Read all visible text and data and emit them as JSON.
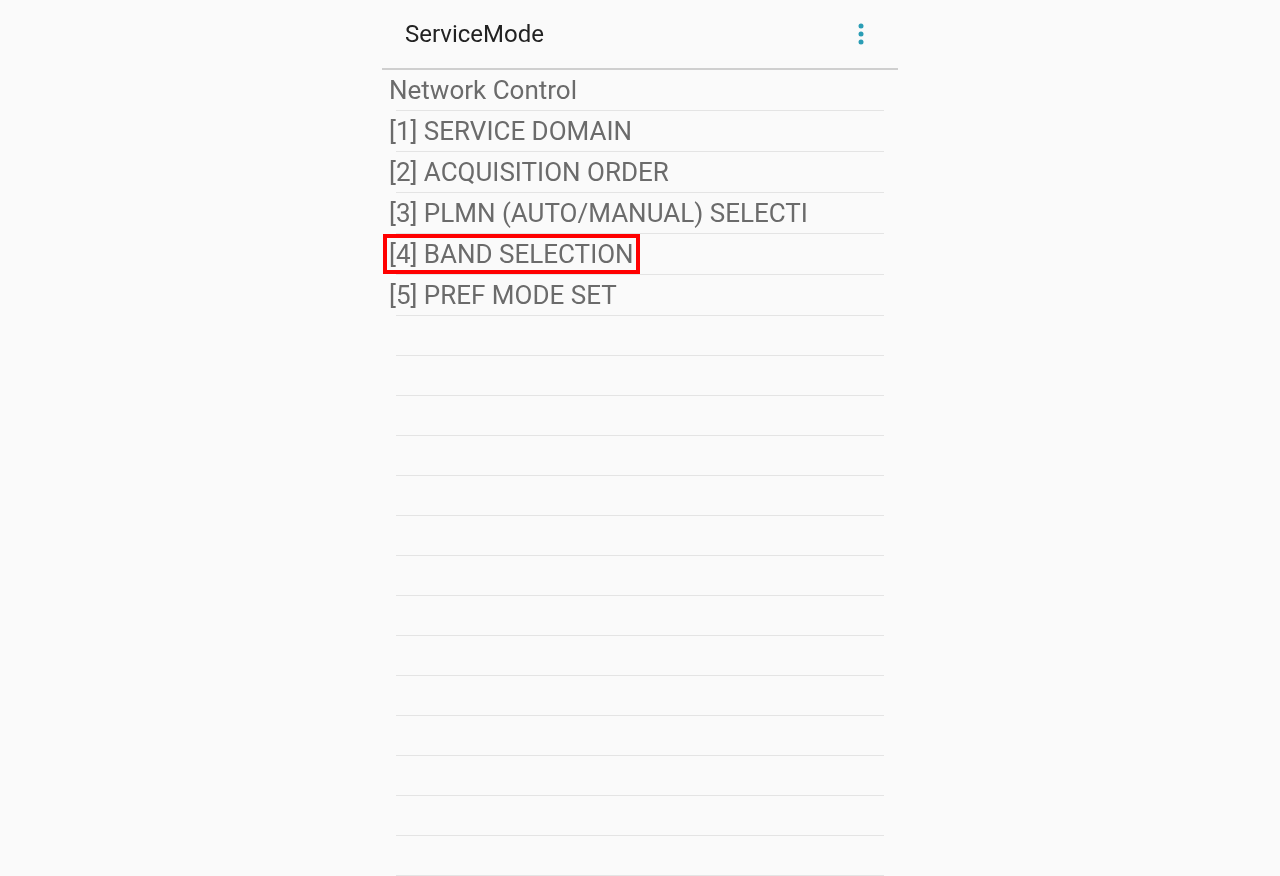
{
  "app_bar": {
    "title": "ServiceMode"
  },
  "items": [
    {
      "label": "Network Control",
      "highlighted": false
    },
    {
      "label": "[1] SERVICE DOMAIN",
      "highlighted": false
    },
    {
      "label": "[2] ACQUISITION ORDER",
      "highlighted": false
    },
    {
      "label": "[3] PLMN (AUTO/MANUAL) SELECTI",
      "highlighted": false
    },
    {
      "label": "[4] BAND SELECTION",
      "highlighted": true
    },
    {
      "label": "[5] PREF MODE SET",
      "highlighted": false
    }
  ]
}
